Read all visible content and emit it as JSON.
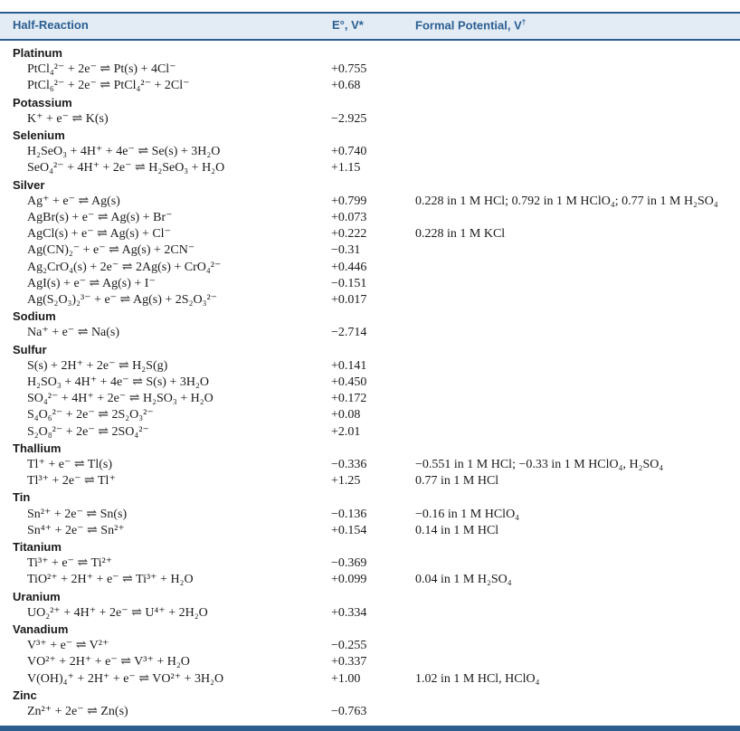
{
  "header": {
    "col1": "Half-Reaction",
    "col2": "E°, V*",
    "col3": "Formal Potential, V",
    "col3_sup": "†"
  },
  "rows": [
    {
      "type": "element",
      "name": "Platinum"
    },
    {
      "type": "reaction",
      "reaction": "PtCl₄²⁻ + 2e⁻ ⇌ Pt(s) + 4Cl⁻",
      "e0": "+0.755",
      "formal": ""
    },
    {
      "type": "reaction",
      "reaction": "PtCl₆²⁻ + 2e⁻ ⇌ PtCl₄²⁻ + 2Cl⁻",
      "e0": "+0.68",
      "formal": ""
    },
    {
      "type": "element",
      "name": "Potassium"
    },
    {
      "type": "reaction",
      "reaction": "K⁺ + e⁻ ⇌ K(s)",
      "e0": "−2.925",
      "formal": ""
    },
    {
      "type": "element",
      "name": "Selenium"
    },
    {
      "type": "reaction",
      "reaction": "H₂SeO₃ + 4H⁺ + 4e⁻ ⇌ Se(s) + 3H₂O",
      "e0": "+0.740",
      "formal": ""
    },
    {
      "type": "reaction",
      "reaction": "SeO₄²⁻ + 4H⁺ + 2e⁻ ⇌ H₂SeO₃ + H₂O",
      "e0": "+1.15",
      "formal": ""
    },
    {
      "type": "element",
      "name": "Silver"
    },
    {
      "type": "reaction",
      "reaction": "Ag⁺ + e⁻ ⇌ Ag(s)",
      "e0": "+0.799",
      "formal": "0.228 in 1 M HCl; 0.792 in 1 M HClO₄; 0.77 in 1 M H₂SO₄"
    },
    {
      "type": "reaction",
      "reaction": "AgBr(s) + e⁻ ⇌ Ag(s) + Br⁻",
      "e0": "+0.073",
      "formal": ""
    },
    {
      "type": "reaction",
      "reaction": "AgCl(s) + e⁻ ⇌ Ag(s) + Cl⁻",
      "e0": "+0.222",
      "formal": "0.228 in 1 M KCl"
    },
    {
      "type": "reaction",
      "reaction": "Ag(CN)₂⁻ + e⁻ ⇌ Ag(s) + 2CN⁻",
      "e0": "−0.31",
      "formal": ""
    },
    {
      "type": "reaction",
      "reaction": "Ag₂CrO₄(s) + 2e⁻ ⇌ 2Ag(s) + CrO₄²⁻",
      "e0": "+0.446",
      "formal": ""
    },
    {
      "type": "reaction",
      "reaction": "AgI(s) + e⁻ ⇌ Ag(s) + I⁻",
      "e0": "−0.151",
      "formal": ""
    },
    {
      "type": "reaction",
      "reaction": "Ag(S₂O₃)₂³⁻ + e⁻ ⇌ Ag(s) + 2S₂O₃²⁻",
      "e0": "+0.017",
      "formal": ""
    },
    {
      "type": "element",
      "name": "Sodium"
    },
    {
      "type": "reaction",
      "reaction": "Na⁺ + e⁻ ⇌ Na(s)",
      "e0": "−2.714",
      "formal": ""
    },
    {
      "type": "element",
      "name": "Sulfur"
    },
    {
      "type": "reaction",
      "reaction": "S(s) + 2H⁺ + 2e⁻ ⇌ H₂S(g)",
      "e0": "+0.141",
      "formal": ""
    },
    {
      "type": "reaction",
      "reaction": "H₂SO₃ + 4H⁺ + 4e⁻ ⇌ S(s) + 3H₂O",
      "e0": "+0.450",
      "formal": ""
    },
    {
      "type": "reaction",
      "reaction": "SO₄²⁻ + 4H⁺ + 2e⁻ ⇌ H₂SO₃ + H₂O",
      "e0": "+0.172",
      "formal": ""
    },
    {
      "type": "reaction",
      "reaction": "S₄O₆²⁻ + 2e⁻ ⇌ 2S₂O₃²⁻",
      "e0": "+0.08",
      "formal": ""
    },
    {
      "type": "reaction",
      "reaction": "S₂O₈²⁻ + 2e⁻ ⇌ 2SO₄²⁻",
      "e0": "+2.01",
      "formal": ""
    },
    {
      "type": "element",
      "name": "Thallium"
    },
    {
      "type": "reaction",
      "reaction": "Tl⁺ + e⁻ ⇌ Tl(s)",
      "e0": "−0.336",
      "formal": "−0.551 in 1 M HCl; −0.33 in 1 M HClO₄, H₂SO₄"
    },
    {
      "type": "reaction",
      "reaction": "Tl³⁺ + 2e⁻ ⇌ Tl⁺",
      "e0": "+1.25",
      "formal": "0.77 in 1 M HCl"
    },
    {
      "type": "element",
      "name": "Tin"
    },
    {
      "type": "reaction",
      "reaction": "Sn²⁺ + 2e⁻ ⇌ Sn(s)",
      "e0": "−0.136",
      "formal": "−0.16 in 1 M HClO₄"
    },
    {
      "type": "reaction",
      "reaction": "Sn⁴⁺ + 2e⁻ ⇌ Sn²⁺",
      "e0": "+0.154",
      "formal": "0.14 in 1 M HCl"
    },
    {
      "type": "element",
      "name": "Titanium"
    },
    {
      "type": "reaction",
      "reaction": "Ti³⁺ + e⁻ ⇌ Ti²⁺",
      "e0": "−0.369",
      "formal": ""
    },
    {
      "type": "reaction",
      "reaction": "TiO²⁺ + 2H⁺ + e⁻ ⇌ Ti³⁺ + H₂O",
      "e0": "+0.099",
      "formal": "0.04 in 1 M H₂SO₄"
    },
    {
      "type": "element",
      "name": "Uranium"
    },
    {
      "type": "reaction",
      "reaction": "UO₂²⁺ + 4H⁺ + 2e⁻ ⇌ U⁴⁺ + 2H₂O",
      "e0": "+0.334",
      "formal": ""
    },
    {
      "type": "element",
      "name": "Vanadium"
    },
    {
      "type": "reaction",
      "reaction": "V³⁺ + e⁻ ⇌ V²⁺",
      "e0": "−0.255",
      "formal": ""
    },
    {
      "type": "reaction",
      "reaction": "VO²⁺ + 2H⁺ + e⁻ ⇌ V³⁺ + H₂O",
      "e0": "+0.337",
      "formal": ""
    },
    {
      "type": "reaction",
      "reaction": "V(OH)₄⁺ + 2H⁺ + e⁻ ⇌ VO²⁺ + 3H₂O",
      "e0": "+1.00",
      "formal": "1.02 in 1 M HCl, HClO₄"
    },
    {
      "type": "element",
      "name": "Zinc"
    },
    {
      "type": "reaction",
      "reaction": "Zn²⁺ + 2e⁻ ⇌ Zn(s)",
      "e0": "−0.763",
      "formal": ""
    }
  ]
}
